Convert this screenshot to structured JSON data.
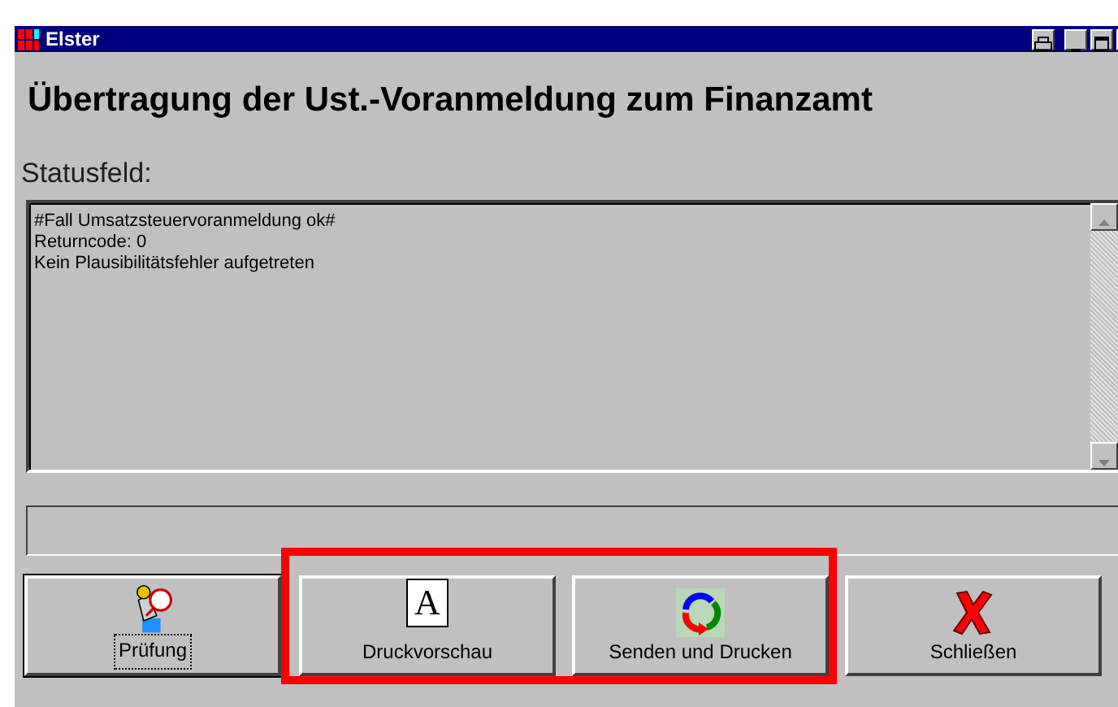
{
  "window": {
    "title": "Elster"
  },
  "heading": "Übertragung der Ust.-Voranmeldung zum Finanzamt",
  "status_label": "Statusfeld:",
  "status_lines": [
    "#Fall Umsatzsteuervoranmeldung ok#",
    "Returncode: 0",
    "Kein Plausibilitätsfehler aufgetreten"
  ],
  "buttons": [
    {
      "label": "Prüfung",
      "kind": "check",
      "focused": true
    },
    {
      "kind": "highlight_frame",
      "color": "#ff0000",
      "buttons": [
        {
          "label": "Druckvorschau",
          "kind": "preview",
          "glyph": "A",
          "focused": false
        },
        {
          "label": "Senden und Drucken",
          "kind": "send",
          "focused": false
        }
      ]
    },
    {
      "label": "Schließen",
      "kind": "close",
      "focused": false
    }
  ]
}
